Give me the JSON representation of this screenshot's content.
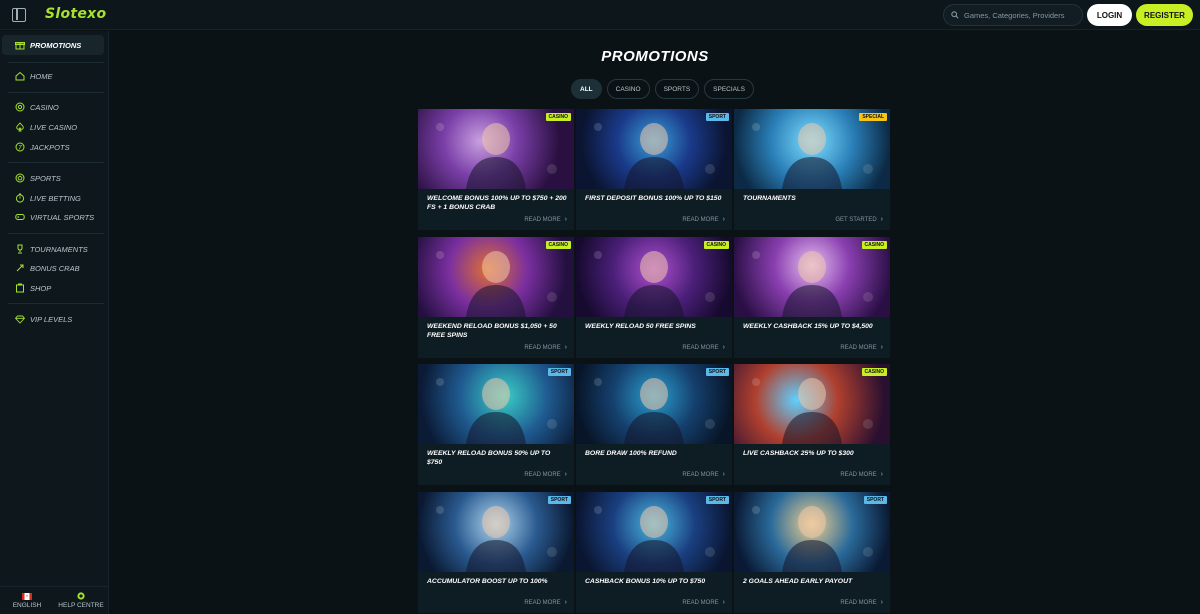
{
  "brand": {
    "name": "Slotexo"
  },
  "header": {
    "search_placeholder": "Games, Categories, Providers",
    "login_label": "LOGIN",
    "register_label": "REGISTER"
  },
  "sidebar": {
    "items": [
      {
        "label": "PROMOTIONS",
        "icon": "gift-icon"
      },
      {
        "label": "HOME",
        "icon": "home-icon"
      },
      {
        "label": "CASINO",
        "icon": "chip-icon"
      },
      {
        "label": "LIVE CASINO",
        "icon": "spade-icon"
      },
      {
        "label": "JACKPOTS",
        "icon": "jackpot-icon"
      },
      {
        "label": "SPORTS",
        "icon": "ball-icon"
      },
      {
        "label": "LIVE BETTING",
        "icon": "stopwatch-icon"
      },
      {
        "label": "VIRTUAL SPORTS",
        "icon": "gamepad-icon"
      },
      {
        "label": "TOURNAMENTS",
        "icon": "trophy-icon"
      },
      {
        "label": "BONUS CRAB",
        "icon": "crab-icon"
      },
      {
        "label": "SHOP",
        "icon": "shop-icon"
      },
      {
        "label": "VIP LEVELS",
        "icon": "diamond-icon"
      }
    ],
    "footer": {
      "language": "ENGLISH",
      "help": "HELP CENTRE"
    }
  },
  "main": {
    "title": "PROMOTIONS",
    "filters": [
      "ALL",
      "CASINO",
      "SPORTS",
      "SPECIALS"
    ],
    "cards": [
      {
        "title": "WELCOME BONUS 100% UP TO $750 + 200 FS + 1 BONUS CRAB",
        "badge": "CASINO",
        "cta": "READ MORE",
        "art": "zeus"
      },
      {
        "title": "FIRST DEPOSIT BONUS 100% UP TO $150",
        "badge": "SPORT",
        "cta": "READ MORE",
        "art": "footballer"
      },
      {
        "title": "TOURNAMENTS",
        "badge": "SPECIAL",
        "cta": "GET STARTED",
        "art": "trophies"
      },
      {
        "title": "WEEKEND RELOAD BONUS $1,050 + 50 FREE SPINS",
        "badge": "CASINO",
        "cta": "READ MORE",
        "art": "zeus-lightning"
      },
      {
        "title": "WEEKLY RELOAD 50 FREE SPINS",
        "badge": "CASINO",
        "cta": "READ MORE",
        "art": "cowboy"
      },
      {
        "title": "WEEKLY CASHBACK 15% UP TO $4,500",
        "badge": "CASINO",
        "cta": "READ MORE",
        "art": "dealer"
      },
      {
        "title": "WEEKLY RELOAD BONUS 50% UP TO $750",
        "badge": "SPORT",
        "cta": "READ MORE",
        "art": "tennis"
      },
      {
        "title": "BORE DRAW 100% REFUND",
        "badge": "SPORT",
        "cta": "READ MORE",
        "art": "soccer"
      },
      {
        "title": "LIVE CASHBACK 25% UP TO $300",
        "badge": "CASINO",
        "cta": "READ MORE",
        "art": "warrior"
      },
      {
        "title": "ACCUMULATOR BOOST UP TO 100%",
        "badge": "SPORT",
        "cta": "READ MORE",
        "art": "football-helmet"
      },
      {
        "title": "CASHBACK BONUS 10% UP TO $750",
        "badge": "SPORT",
        "cta": "READ MORE",
        "art": "runner"
      },
      {
        "title": "2 GOALS AHEAD EARLY PAYOUT",
        "badge": "SPORT",
        "cta": "READ MORE",
        "art": "basketball"
      }
    ]
  },
  "colors": {
    "accent": "#c8ef24",
    "background": "#0a1216",
    "badge_casino": "#c8ef24",
    "badge_sport": "#5bb8e8",
    "badge_special": "#f5c518"
  }
}
